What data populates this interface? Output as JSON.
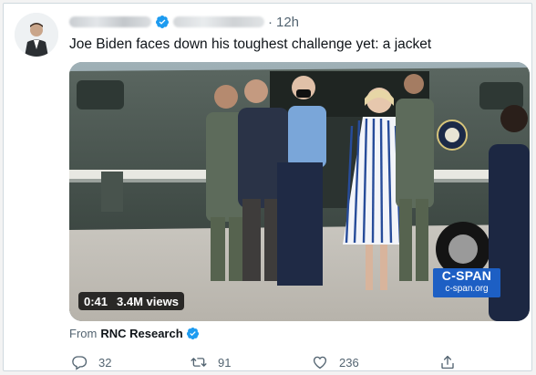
{
  "tweet": {
    "time": "12h",
    "separator": "·",
    "text": "Joe Biden faces down his toughest challenge yet: a jacket",
    "from_label": "From",
    "source_name": "RNC Research"
  },
  "video": {
    "duration": "0:41",
    "views": "3.4M views",
    "watermark_title": "C-SPAN",
    "watermark_url": "c-span.org"
  },
  "actions": {
    "reply_count": "32",
    "retweet_count": "91",
    "like_count": "236"
  },
  "colors": {
    "verified": "#1d9bf0",
    "muted": "#536471",
    "cspan_blue": "#1d5fc4"
  },
  "icons": [
    "verified-badge-icon",
    "reply-icon",
    "retweet-icon",
    "like-icon",
    "share-icon"
  ]
}
